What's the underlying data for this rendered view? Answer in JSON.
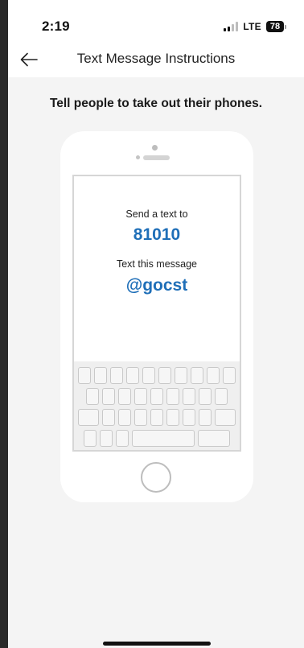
{
  "status_bar": {
    "time": "2:19",
    "network": "LTE",
    "battery": "78",
    "icons": [
      "signal-icon",
      "battery-icon"
    ]
  },
  "nav": {
    "back_icon": "arrow-left-icon",
    "title": "Text Message Instructions"
  },
  "instruction": "Tell people to take out their phones.",
  "phone_mock": {
    "send_label": "Send a text to",
    "shortcode": "81010",
    "message_label": "Text this message",
    "keyword": "@gocst"
  },
  "colors": {
    "accent": "#1f6fb8",
    "background": "#f4f4f4"
  }
}
